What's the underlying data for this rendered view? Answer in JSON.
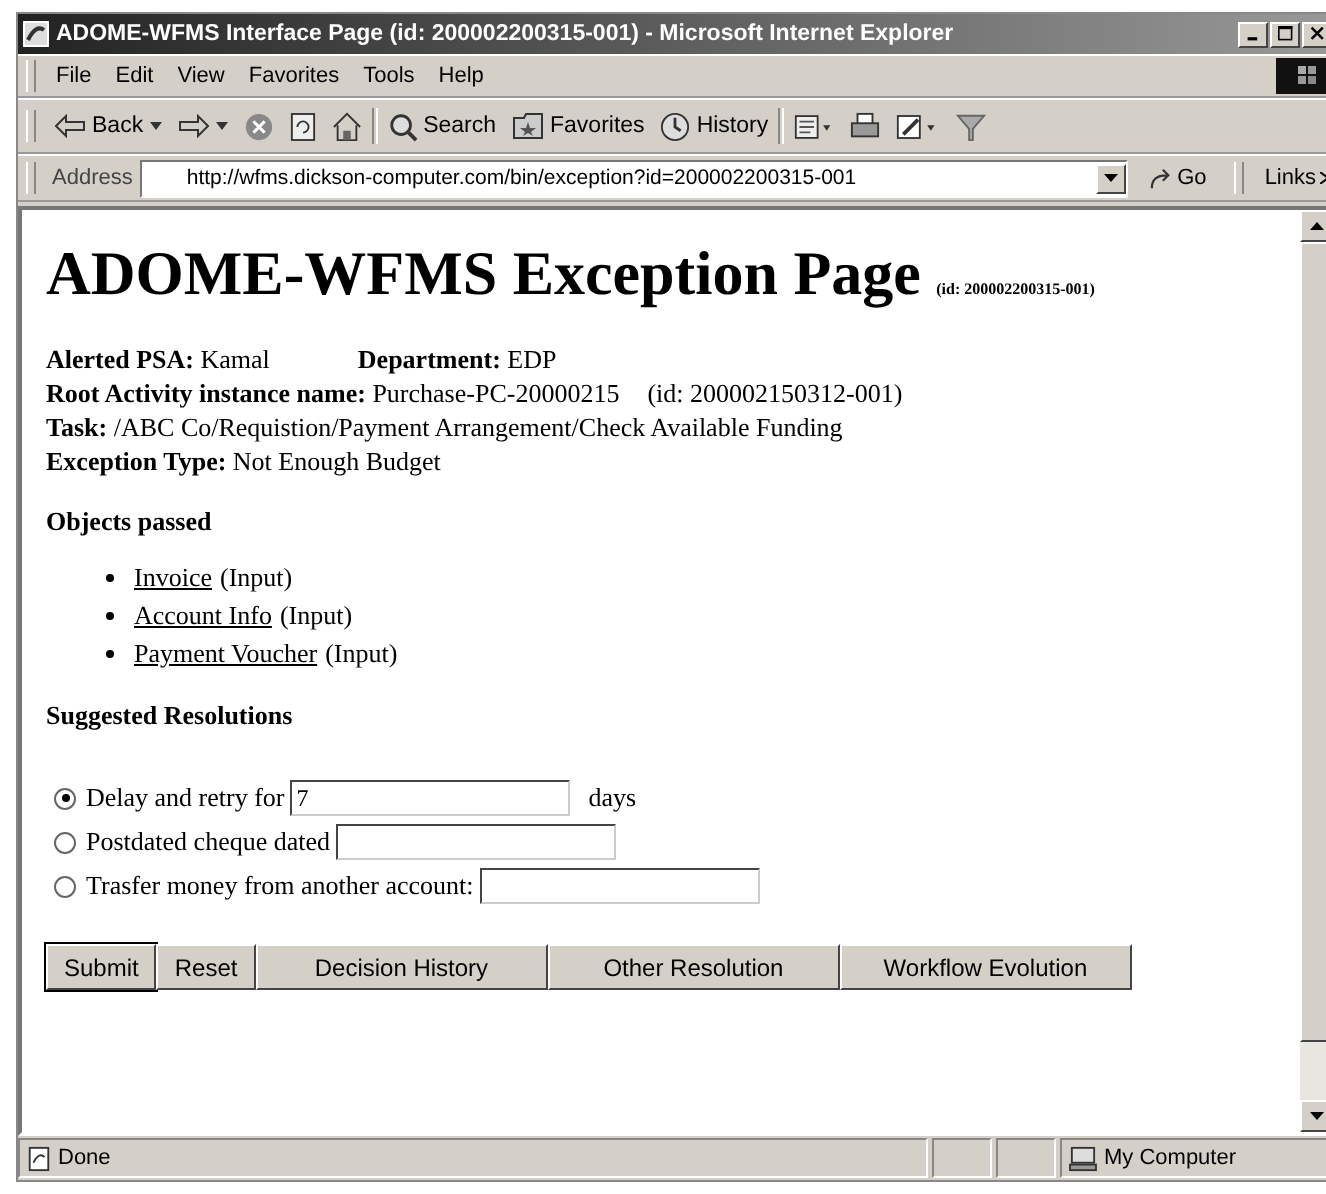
{
  "window": {
    "title": "ADOME-WFMS Interface Page (id: 200002200315-001) - Microsoft Internet Explorer"
  },
  "menu": [
    "File",
    "Edit",
    "View",
    "Favorites",
    "Tools",
    "Help"
  ],
  "toolbar": [
    {
      "kind": "back",
      "label": "Back"
    },
    {
      "kind": "forward"
    },
    {
      "kind": "stop"
    },
    {
      "kind": "refresh"
    },
    {
      "kind": "home"
    },
    {
      "kind": "search",
      "label": "Search"
    },
    {
      "kind": "favorites",
      "label": "Favorites"
    },
    {
      "kind": "history",
      "label": "History"
    },
    {
      "kind": "mail"
    },
    {
      "kind": "print"
    },
    {
      "kind": "edit"
    },
    {
      "kind": "messenger"
    }
  ],
  "address": {
    "label": "Address",
    "url": "http://wfms.dickson-computer.com/bin/exception?id=200002200315-001",
    "go": "Go",
    "links": "Links"
  },
  "page": {
    "title": "ADOME-WFMS Exception Page",
    "title_id": "(id: 200002200315-001)",
    "details": [
      {
        "items": [
          {
            "kind": "field",
            "label": "Alerted PSA:",
            "value": "Kamal"
          },
          {
            "kind": "field",
            "label": "Department:",
            "value": "EDP"
          }
        ]
      },
      {
        "items": [
          {
            "kind": "field",
            "label": "Root Activity instance name:",
            "value": "Purchase-PC-20000215"
          },
          {
            "kind": "note",
            "value": "(id: 200002150312-001)"
          }
        ]
      },
      {
        "items": [
          {
            "kind": "field",
            "label": "Task:",
            "value": "/ABC Co/Requistion/Payment Arrangement/Check Available Funding"
          }
        ]
      },
      {
        "items": [
          {
            "kind": "field",
            "label": "Exception Type:",
            "value": "Not Enough Budget"
          }
        ]
      }
    ],
    "objects_heading": "Objects passed",
    "objects": [
      {
        "link": "Invoice",
        "note": "(Input)"
      },
      {
        "link": "Account Info",
        "note": "(Input)"
      },
      {
        "link": "Payment Voucher",
        "note": "(Input)"
      }
    ],
    "resolutions_heading": "Suggested Resolutions",
    "resolutions": [
      {
        "label": "Delay and retry for",
        "selected": true,
        "value": "7",
        "suffix": "days"
      },
      {
        "label": "Postdated cheque dated",
        "selected": false
      },
      {
        "label": "Trasfer money from another account:",
        "selected": false
      }
    ],
    "buttons": [
      {
        "label": "Submit",
        "default": true
      },
      {
        "label": "Reset",
        "default": false
      },
      {
        "label": "Decision History",
        "default": false
      },
      {
        "label": "Other Resolution",
        "default": false
      },
      {
        "label": "Workflow Evolution",
        "default": false
      }
    ]
  },
  "status_bar": {
    "text": "Done",
    "zone": "My Computer"
  }
}
